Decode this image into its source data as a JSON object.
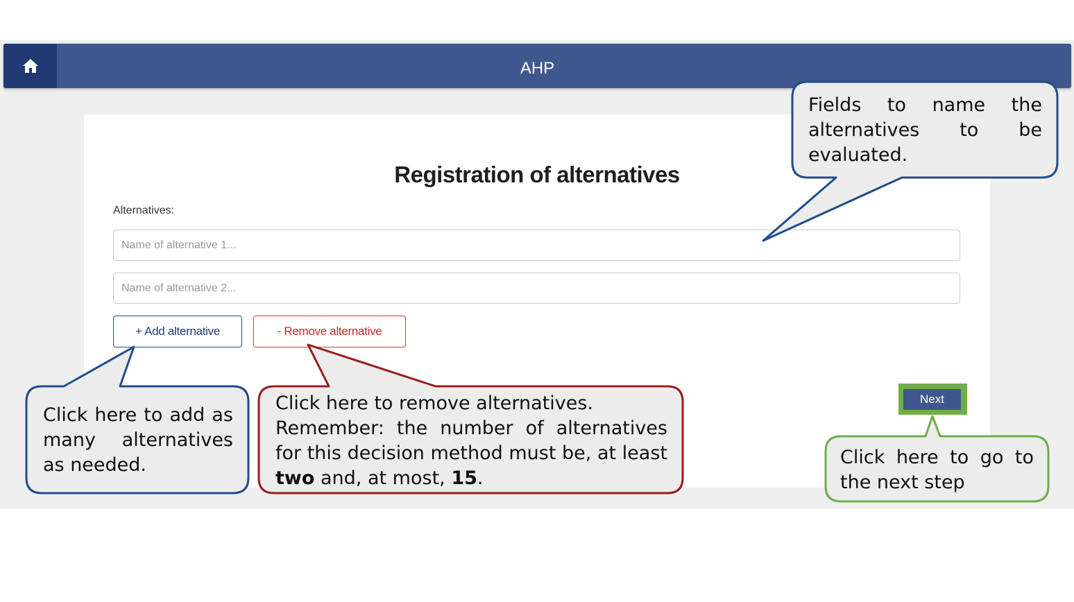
{
  "navbar": {
    "title": "AHP",
    "home_icon": "home-icon",
    "home_color": "#223a73",
    "bar_color": "#3f578c"
  },
  "form": {
    "title": "Registration of alternatives",
    "alternatives_label": "Alternatives:",
    "inputs": [
      {
        "value": "",
        "placeholder": "Name of alternative 1..."
      },
      {
        "value": "",
        "placeholder": "Name of alternative 2..."
      }
    ],
    "add_button": "+ Add alternative",
    "remove_button": "- Remove alternative",
    "next_button": "Next"
  },
  "callouts": {
    "fields": {
      "text": "Fields to name the alternatives to be evaluated.",
      "border_color": "#1f4e8c"
    },
    "add": {
      "text": "Click here to add as many alternatives as needed.",
      "border_color": "#1f4e8c"
    },
    "remove": {
      "line1": "Click here to remove alternatives.",
      "line2_prefix": "Remember: the number of alternatives for this decision method must be, at least",
      "min_value": "two",
      "line2_mid": "and, at most,",
      "max_value": "15",
      "line2_suffix": ".",
      "border_color": "#9b1c1c"
    },
    "next": {
      "text": "Click here to go to the next step",
      "border_color": "#70ad47"
    }
  }
}
